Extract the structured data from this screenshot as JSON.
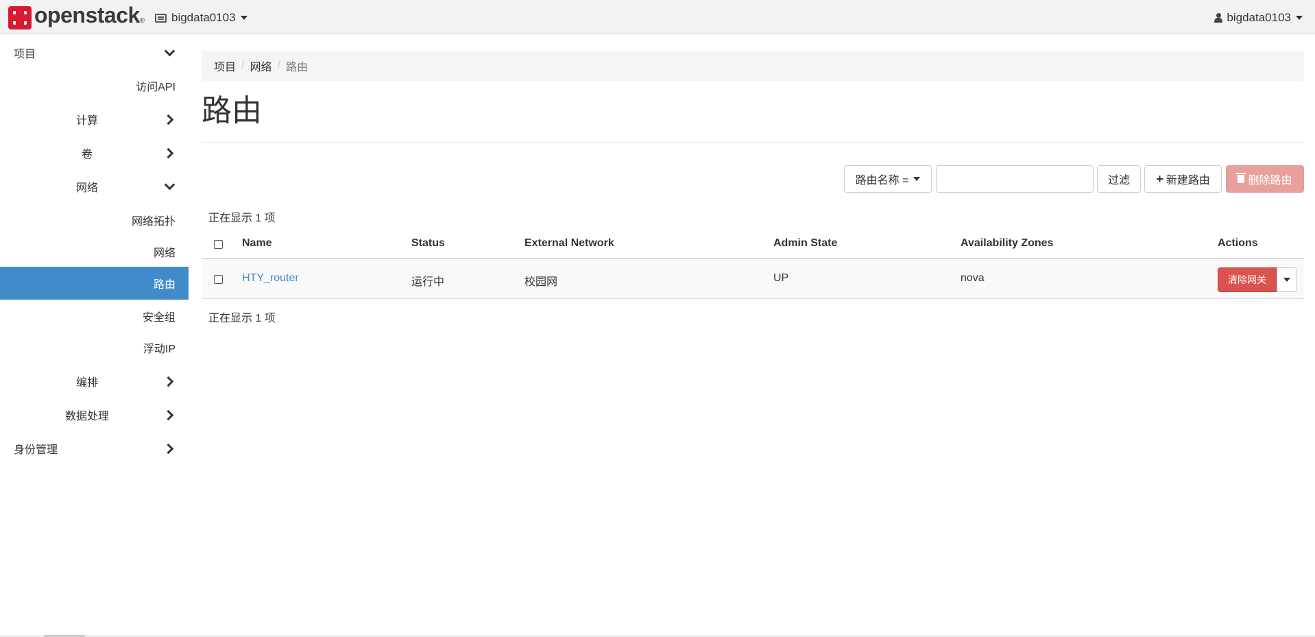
{
  "topbar": {
    "logo_text": "openstack",
    "logo_mark": "®",
    "project": "bigdata0103",
    "user": "bigdata0103"
  },
  "sidebar": {
    "project": "项目",
    "access_api": "访问API",
    "compute": "计算",
    "volumes": "卷",
    "network": "网络",
    "network_topology": "网络拓扑",
    "networks": "网络",
    "routers": "路由",
    "security_groups": "安全组",
    "floating_ip": "浮动IP",
    "orchestration": "编排",
    "data_processing": "数据处理",
    "identity": "身份管理"
  },
  "breadcrumb": [
    "项目",
    "网络",
    "路由"
  ],
  "page_title": "路由",
  "toolbar": {
    "filter_field": "路由名称 =",
    "filter_value": "",
    "filter_button": "过滤",
    "create_button": "新建路由",
    "delete_button": "删除路由"
  },
  "count_text": "正在显示 1 项",
  "table": {
    "headers": {
      "name": "Name",
      "status": "Status",
      "external_network": "External Network",
      "admin_state": "Admin State",
      "availability_zones": "Availability Zones",
      "actions": "Actions"
    },
    "rows": [
      {
        "name": "HTY_router",
        "status": "运行中",
        "external_network": "校园网",
        "admin_state": "UP",
        "availability_zones": "nova",
        "action": "清除网关"
      }
    ]
  },
  "colors": {
    "accent": "#428bca",
    "danger": "#d9534f",
    "brand": "#da1a32"
  }
}
